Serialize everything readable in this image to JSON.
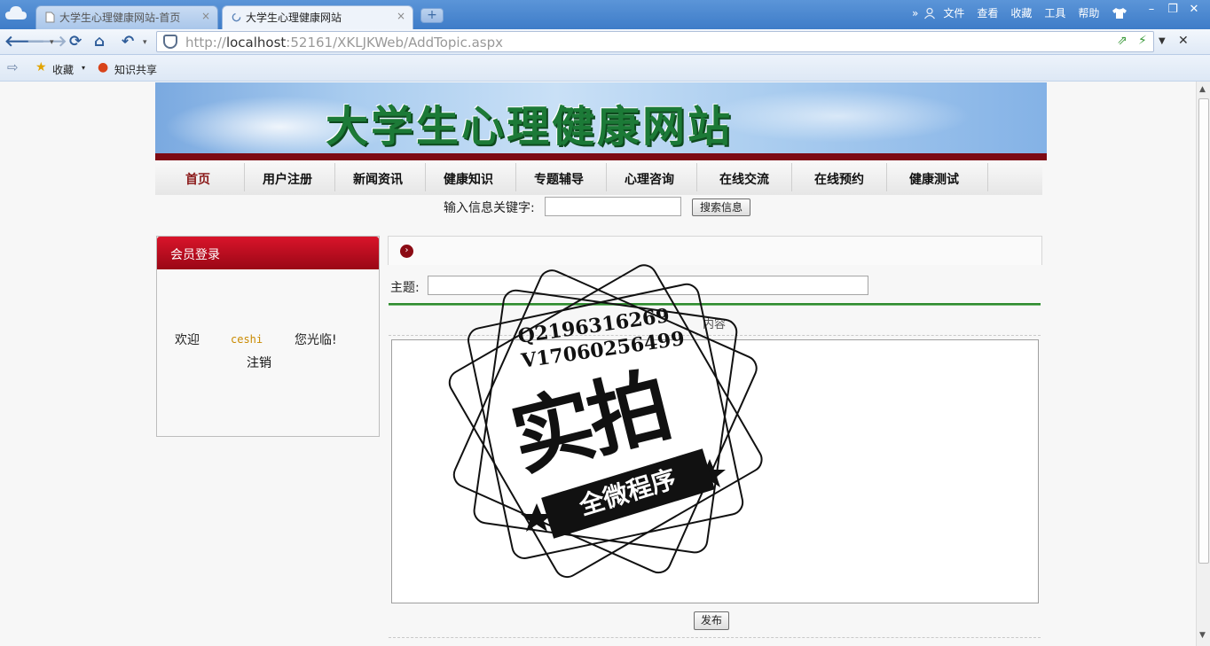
{
  "browser": {
    "tabs": [
      {
        "label": "大学生心理健康网站-首页",
        "active": false
      },
      {
        "label": "大学生心理健康网站",
        "active": true
      }
    ],
    "new_tab_symbol": "+",
    "close_symbol": "×",
    "top_menu": [
      "文件",
      "查看",
      "收藏",
      "工具",
      "帮助"
    ],
    "url_prefix": "http://",
    "url_host": "localhost",
    "url_rest": ":52161/XKLJKWeb/AddTopic.aspx",
    "favorites": [
      "收藏",
      "知识共享"
    ],
    "icons": [
      "cloud-logo-icon",
      "back-icon",
      "forward-icon",
      "refresh-icon",
      "home-icon",
      "undo-icon",
      "shield-icon",
      "share-icon",
      "bolt-icon",
      "dropdown-icon",
      "close-icon",
      "star-icon",
      "globe-icon",
      "shirt-icon",
      "user-icon",
      "minimize-icon",
      "maximize-icon"
    ]
  },
  "site": {
    "banner_title": "大学生心理健康网站",
    "nav": [
      "首页",
      "用户注册",
      "新闻资讯",
      "健康知识",
      "专题辅导",
      "心理咨询",
      "在线交流",
      "在线预约",
      "健康测试"
    ],
    "search_label": "输入信息关键字:",
    "search_button": "搜索信息",
    "login_box": {
      "title": "会员登录",
      "welcome": "欢迎",
      "username": "ceshi",
      "visit": "您光临!",
      "logout": "注销"
    },
    "form": {
      "subject_label": "主题:",
      "content_label": "内容",
      "publish_button": "发布"
    }
  },
  "watermark": {
    "line1": "Q2196316269",
    "line2": "V17060256499",
    "big": "实拍",
    "ribbon": "全微程序"
  },
  "colors": {
    "accent_red": "#9a0716",
    "title_green": "#1c7a37",
    "nav_current": "#8b1a1a",
    "chrome_blue": "#3e7cc8"
  }
}
